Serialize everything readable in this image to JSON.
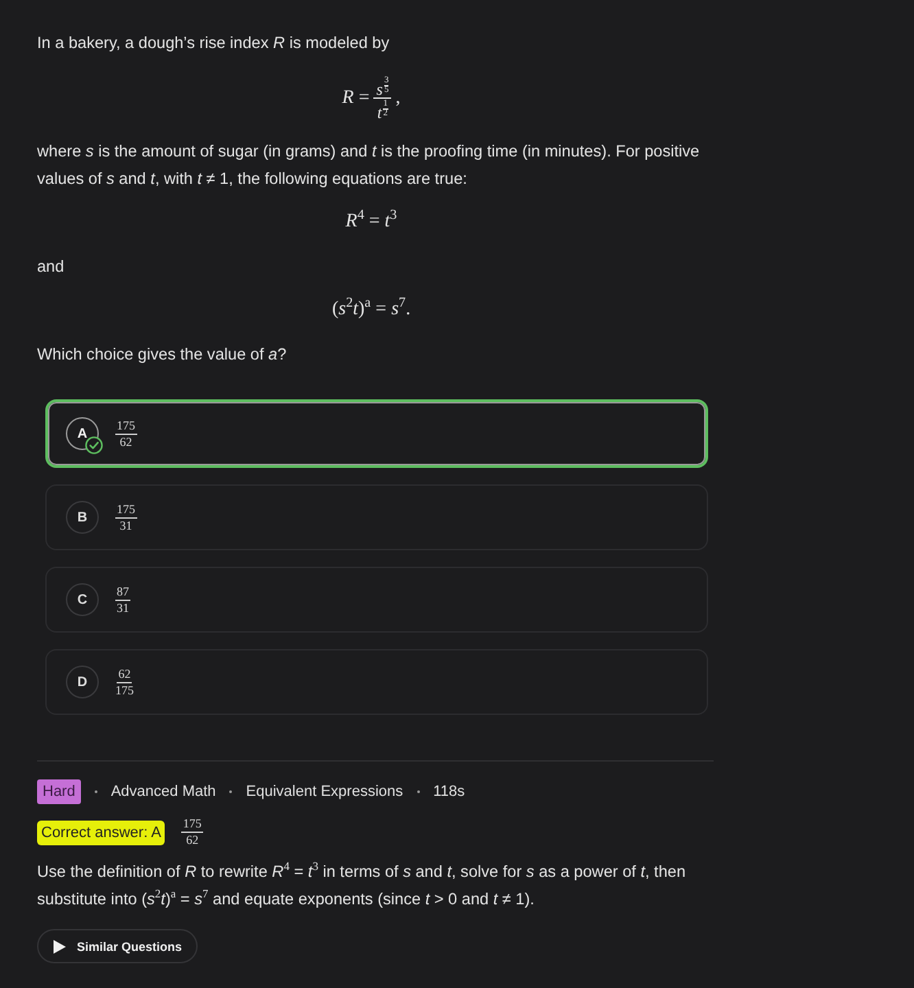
{
  "question": {
    "blocks": [
      {
        "kind": "text",
        "text": "In a bakery, a dough’s rise index *R* is modeled by"
      },
      {
        "kind": "fraction",
        "lhs": "*R* =",
        "numerator": {
          "base": "s",
          "exp_numerator": "3",
          "exp_denominator": "5"
        },
        "denominator": {
          "base": "t",
          "exp_numerator": "1",
          "exp_denominator": "2"
        },
        "trail": ","
      },
      {
        "kind": "text",
        "text": "where *s* is the amount of sugar (in grams) and *t* is the proofing time (in minutes). For positive values of *s* and *t*, with *t* ≠ 1, the following equations are true:"
      },
      {
        "kind": "equation",
        "text": "*R*$^{4}$ = *t*$^{3}$"
      },
      {
        "kind": "text",
        "text": "and"
      },
      {
        "kind": "equation",
        "text": "(*s*$^{2}$*t*)$^{a}$ = *s*$^{7}$."
      },
      {
        "kind": "text",
        "text": "Which choice gives the value of *a*?"
      }
    ]
  },
  "options": [
    {
      "letter": "A",
      "numerator": "175",
      "denominator": "62",
      "selected": true,
      "correct": true
    },
    {
      "letter": "B",
      "numerator": "175",
      "denominator": "31",
      "selected": false,
      "correct": false
    },
    {
      "letter": "C",
      "numerator": "87",
      "denominator": "31",
      "selected": false,
      "correct": false
    },
    {
      "letter": "D",
      "numerator": "62",
      "denominator": "175",
      "selected": false,
      "correct": false
    }
  ],
  "meta": {
    "difficulty": "Hard",
    "tags": [
      "Advanced Math",
      "Equivalent Expressions",
      "118s"
    ]
  },
  "answer": {
    "label": "Correct answer: A",
    "numerator": "175",
    "denominator": "62"
  },
  "explanation": "Use the definition of *R* to rewrite *R*$^{4}$ = *t*$^{3}$ in terms of *s* and *t*, solve for *s* as a power of *t*, then substitute into (*s*$^{2}$*t*)$^{a}$ = *s*$^{7}$ and equate exponents (since *t* > 0 and *t* ≠ 1).",
  "similar_button": "Similar Questions"
}
